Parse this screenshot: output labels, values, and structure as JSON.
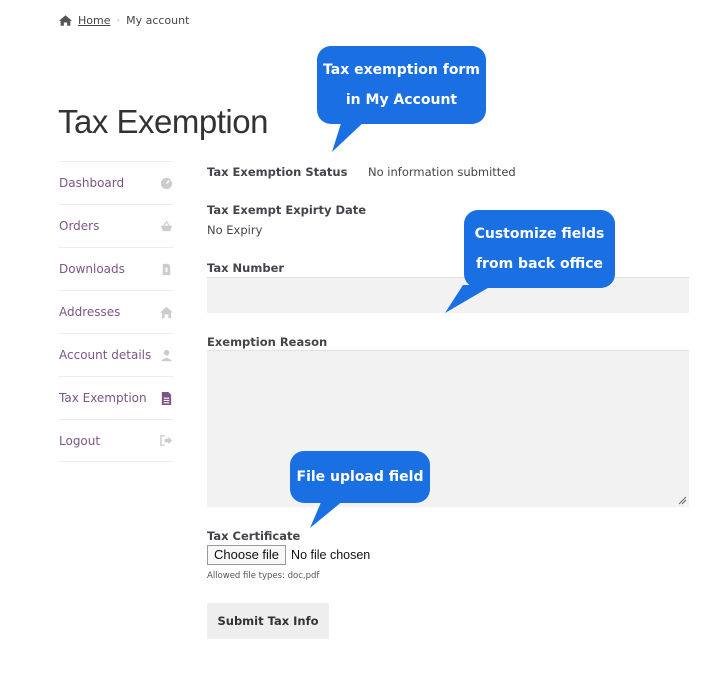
{
  "breadcrumb": {
    "home_icon": "home-icon",
    "home_label": "Home",
    "separator": "›",
    "current": "My account"
  },
  "page_title": "Tax Exemption",
  "sidebar": {
    "items": [
      {
        "label": "Dashboard",
        "icon": "dashboard-gauge-icon",
        "active": false
      },
      {
        "label": "Orders",
        "icon": "basket-icon",
        "active": false
      },
      {
        "label": "Downloads",
        "icon": "file-download-icon",
        "active": false
      },
      {
        "label": "Addresses",
        "icon": "home-icon",
        "active": false
      },
      {
        "label": "Account details",
        "icon": "user-icon",
        "active": false
      },
      {
        "label": "Tax Exemption",
        "icon": "document-icon",
        "active": true
      },
      {
        "label": "Logout",
        "icon": "sign-out-icon",
        "active": false
      }
    ]
  },
  "form": {
    "status_label": "Tax Exemption Status",
    "status_value": "No information submitted",
    "expiry_label": "Tax Exempt Expirty Date",
    "expiry_value": "No Expiry",
    "tax_number_label": "Tax Number",
    "tax_number_value": "",
    "reason_label": "Exemption Reason",
    "reason_value": "",
    "certificate_label": "Tax Certificate",
    "choose_file_label": "Choose file",
    "file_status": "No file chosen",
    "allowed_types": "Allowed file types: doc,pdf",
    "submit_label": "Submit Tax Info"
  },
  "callouts": {
    "account_form": [
      "Tax exemption form",
      "in My Account"
    ],
    "customize": [
      "Customize fields",
      "from back office"
    ],
    "file_upload": [
      "File upload field"
    ]
  },
  "colors": {
    "callout_blue": "#1a6fe3",
    "link_purple": "#7c5585",
    "input_bg": "#f2f2f2"
  }
}
